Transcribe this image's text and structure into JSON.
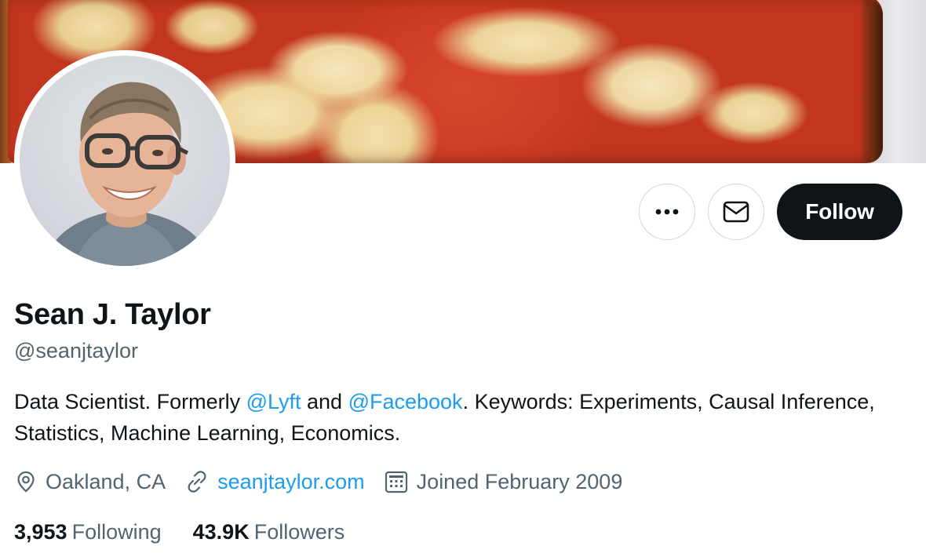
{
  "profile": {
    "name": "Sean J. Taylor",
    "handle": "@seanjtaylor",
    "bio": {
      "part1": "Data Scientist. Formerly ",
      "mention1": "@Lyft",
      "part2": " and ",
      "mention2": "@Facebook",
      "part3": ". Keywords: Experiments, Causal Inference, Statistics, Machine Learning, Economics."
    },
    "location": "Oakland, CA",
    "website": "seanjtaylor.com",
    "joined": "Joined February 2009",
    "following_count": "3,953",
    "following_label": "Following",
    "followers_count": "43.9K",
    "followers_label": "Followers"
  },
  "actions": {
    "follow_label": "Follow"
  },
  "icons": {
    "more": "more-horizontal-icon",
    "message": "envelope-icon",
    "location": "location-pin-icon",
    "link": "link-icon",
    "calendar": "calendar-icon"
  },
  "colors": {
    "link": "#1d9bf0",
    "text": "#0f1419",
    "muted": "#536471",
    "button_dark": "#0f1419",
    "border": "#cfd9de"
  }
}
